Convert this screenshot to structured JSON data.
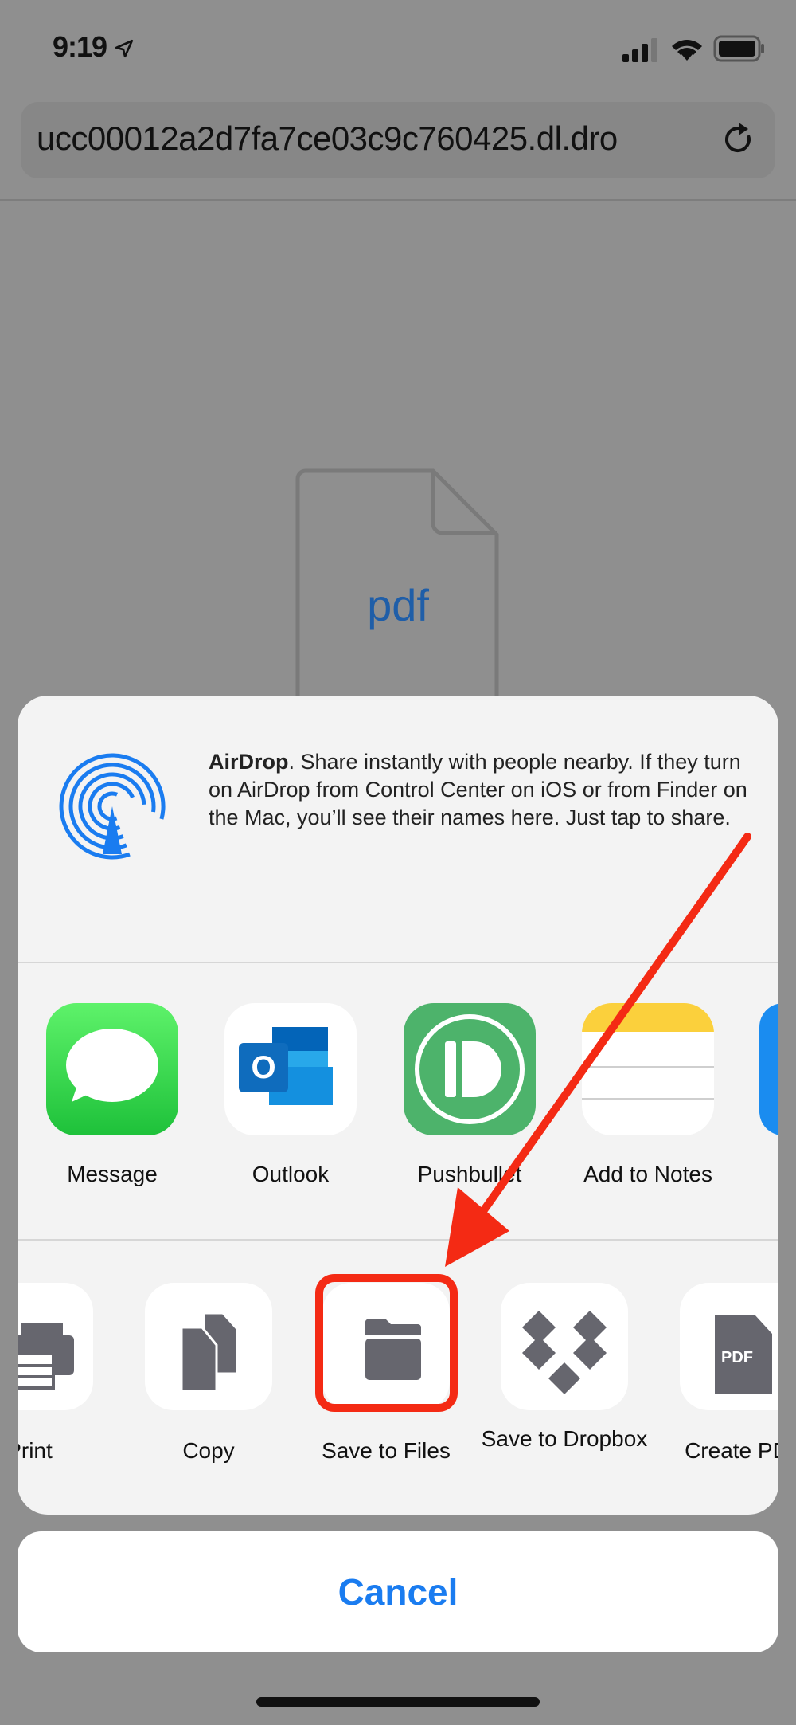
{
  "status_bar": {
    "time": "9:19",
    "icons": [
      "location-arrow-icon",
      "cellular-signal-icon",
      "wifi-icon",
      "battery-icon"
    ]
  },
  "browser": {
    "url": "ucc00012a2d7fa7ce03c9c760425.dl.dro",
    "reload_icon": "reload-icon"
  },
  "document": {
    "file_type": "pdf"
  },
  "share_sheet": {
    "airdrop": {
      "title": "AirDrop",
      "description": ". Share instantly with people nearby. If they turn on AirDrop from Control Center on iOS or from Finder on the Mac, you’ll see their names here. Just tap to share."
    },
    "apps": [
      {
        "label": "Message"
      },
      {
        "label": "Outlook"
      },
      {
        "label": "Pushbullet"
      },
      {
        "label": "Add to Notes"
      }
    ],
    "actions": [
      {
        "label": "Print"
      },
      {
        "label": "Copy"
      },
      {
        "label": "Save to Files"
      },
      {
        "label": "Save to Dropbox"
      },
      {
        "label": "Create PDF"
      }
    ],
    "highlight_color": "#f42a14"
  },
  "cancel_label": "Cancel",
  "colors": {
    "accent": "#1a7cf0",
    "annotation": "#f42a14"
  }
}
